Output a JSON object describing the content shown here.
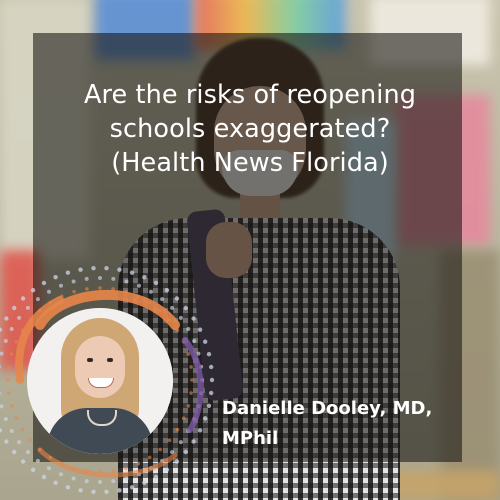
{
  "headline": {
    "line1": "Are the risks of reopening",
    "line2": "schools exaggerated?",
    "line3": "(Health News Florida)"
  },
  "author": {
    "line1": "Danielle Dooley, MD,",
    "line2": "MPhil"
  },
  "colors": {
    "overlay": "#161412",
    "headline_text": "#ffffff",
    "ring_orange": "#e8864a",
    "ring_dots": "#cdd5e6",
    "ring_purple": "#7d5aa6"
  },
  "icons": {
    "portrait": "person-photo",
    "ring": "dotted-circle-decoration"
  }
}
